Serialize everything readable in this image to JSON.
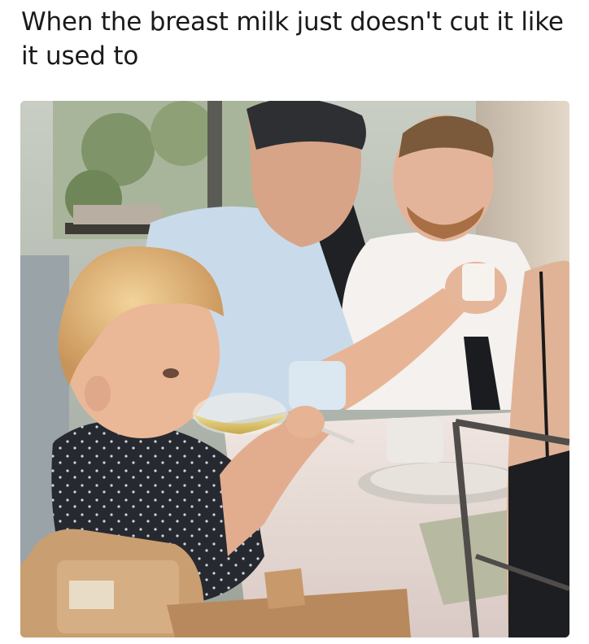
{
  "caption": {
    "text": "When the breast milk just doesn't cut it like it used to"
  },
  "photo": {
    "description_icon": "restaurant-photo",
    "colors": {
      "wall_left": "#cfcfc6",
      "wall_right": "#d8cdbd",
      "tablecloth": "#ece0da",
      "child_hair": "#e4b878",
      "child_shirt": "#2a2d33",
      "man_shirt_blue": "#c9dbea",
      "man_shirt_white": "#f4f1ee",
      "skin": "#e9b79a",
      "wine": "#d9c26a",
      "highchair": "#caa175"
    }
  }
}
